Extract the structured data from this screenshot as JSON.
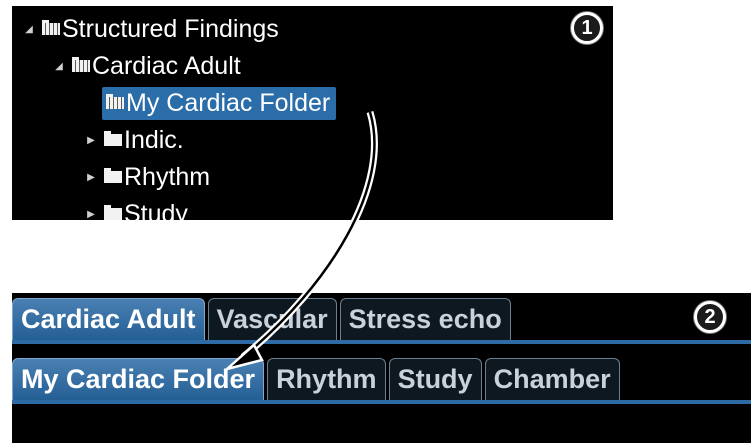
{
  "tree": {
    "items": [
      {
        "label": "Structured Findings",
        "expanded": true
      },
      {
        "label": "Cardiac Adult",
        "expanded": true
      },
      {
        "label": "My Cardiac Folder",
        "selected": true
      },
      {
        "label": "Indic.",
        "expanded": false
      },
      {
        "label": "Rhythm",
        "expanded": false
      },
      {
        "label": "Study",
        "expanded": false
      }
    ]
  },
  "callouts": {
    "one": "1",
    "two": "2"
  },
  "tabs": {
    "top": [
      "Cardiac Adult",
      "Vascular",
      "Stress echo"
    ],
    "bottom": [
      "My Cardiac Folder",
      "Rhythm",
      "Study",
      "Chamber"
    ]
  },
  "colors": {
    "selection": "#2b6da8",
    "active_tab": "#2f6fa6",
    "background": "#000000"
  }
}
